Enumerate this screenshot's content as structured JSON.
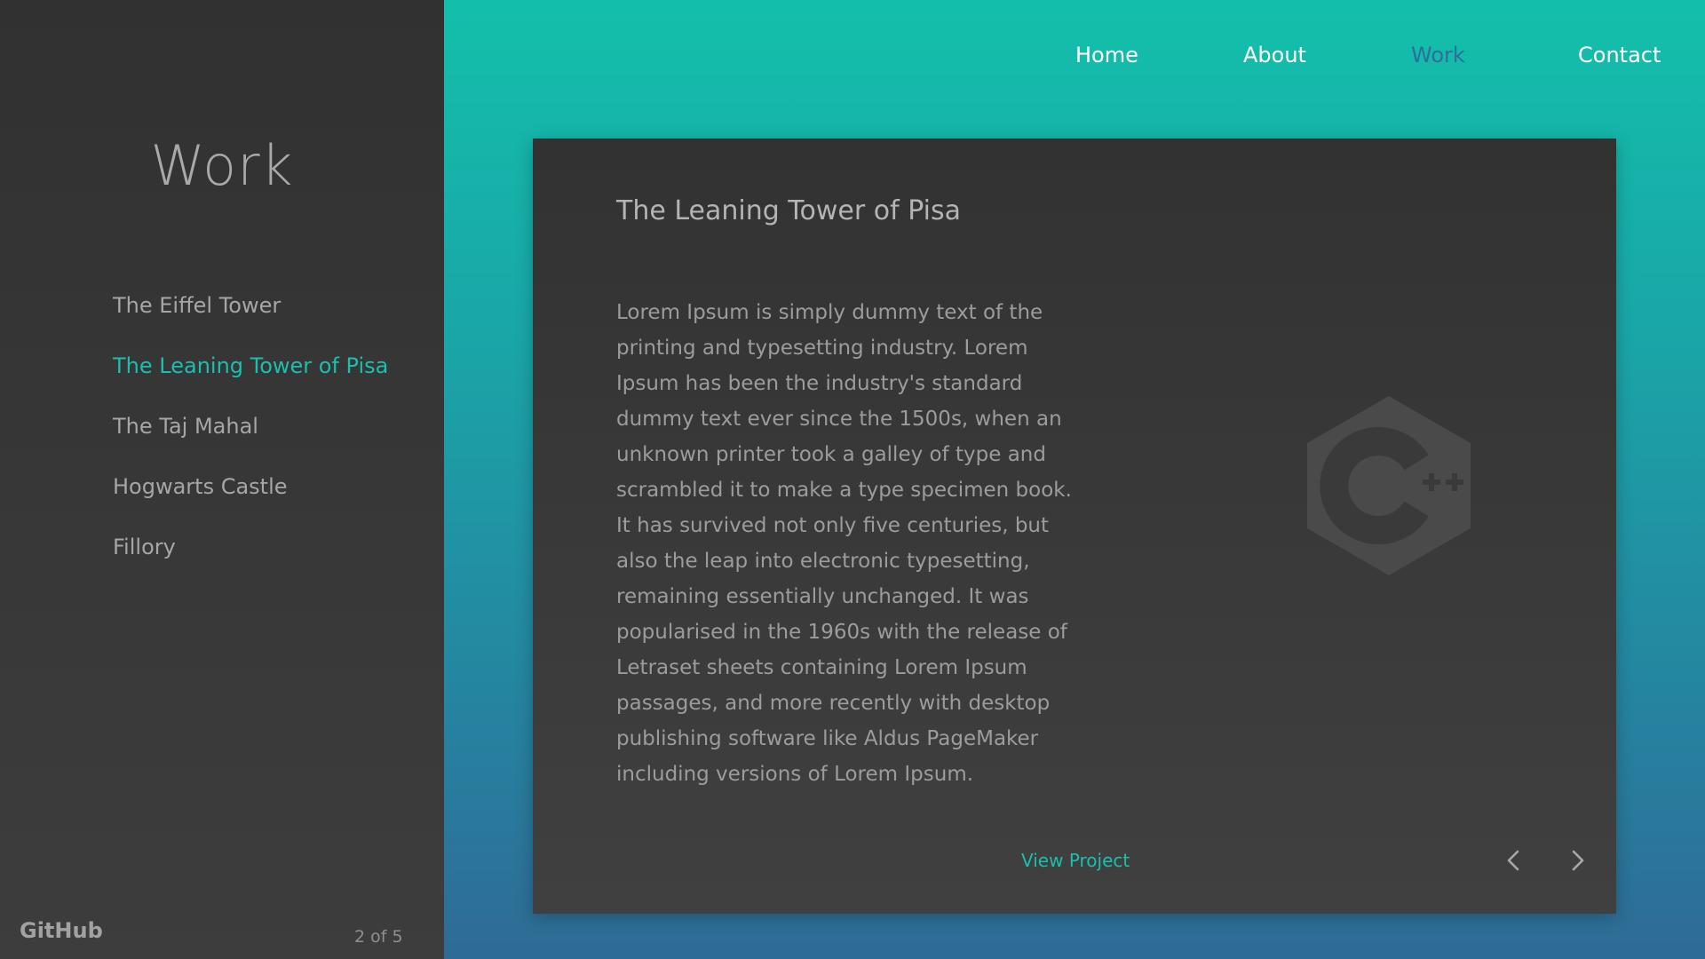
{
  "sidebar": {
    "title": "Work",
    "projects": [
      {
        "label": "The Eiffel Tower"
      },
      {
        "label": "The Leaning Tower of Pisa"
      },
      {
        "label": "The Taj Mahal"
      },
      {
        "label": "Hogwarts Castle"
      },
      {
        "label": "Fillory"
      }
    ],
    "active_index": 1,
    "github_label": "GitHub",
    "counter": "2 of 5"
  },
  "nav": {
    "items": [
      {
        "label": "Home"
      },
      {
        "label": "About"
      },
      {
        "label": "Work"
      },
      {
        "label": "Contact"
      }
    ],
    "active": "Work"
  },
  "card": {
    "title": "The Leaning Tower of Pisa",
    "body": "Lorem Ipsum is simply dummy text of the printing and typesetting industry. Lorem Ipsum has been the industry's standard dummy text ever since the 1500s, when an unknown printer took a galley of type and scrambled it to make a type specimen book. It has survived not only five centuries, but also the leap into electronic typesetting, remaining essentially unchanged. It was popularised in the 1960s with the release of Letraset sheets containing Lorem Ipsum passages, and more recently with desktop publishing software like Aldus PageMaker including versions of Lorem Ipsum.",
    "logo_icon": "cpp-logo-icon",
    "view_project_label": "View Project",
    "prev_icon": "chevron-left-icon",
    "next_icon": "chevron-right-icon"
  },
  "colors": {
    "accent": "#1bbfae",
    "nav_active": "#2d6f9a",
    "sidebar_bg": "#333333",
    "card_bg": "#383838"
  }
}
